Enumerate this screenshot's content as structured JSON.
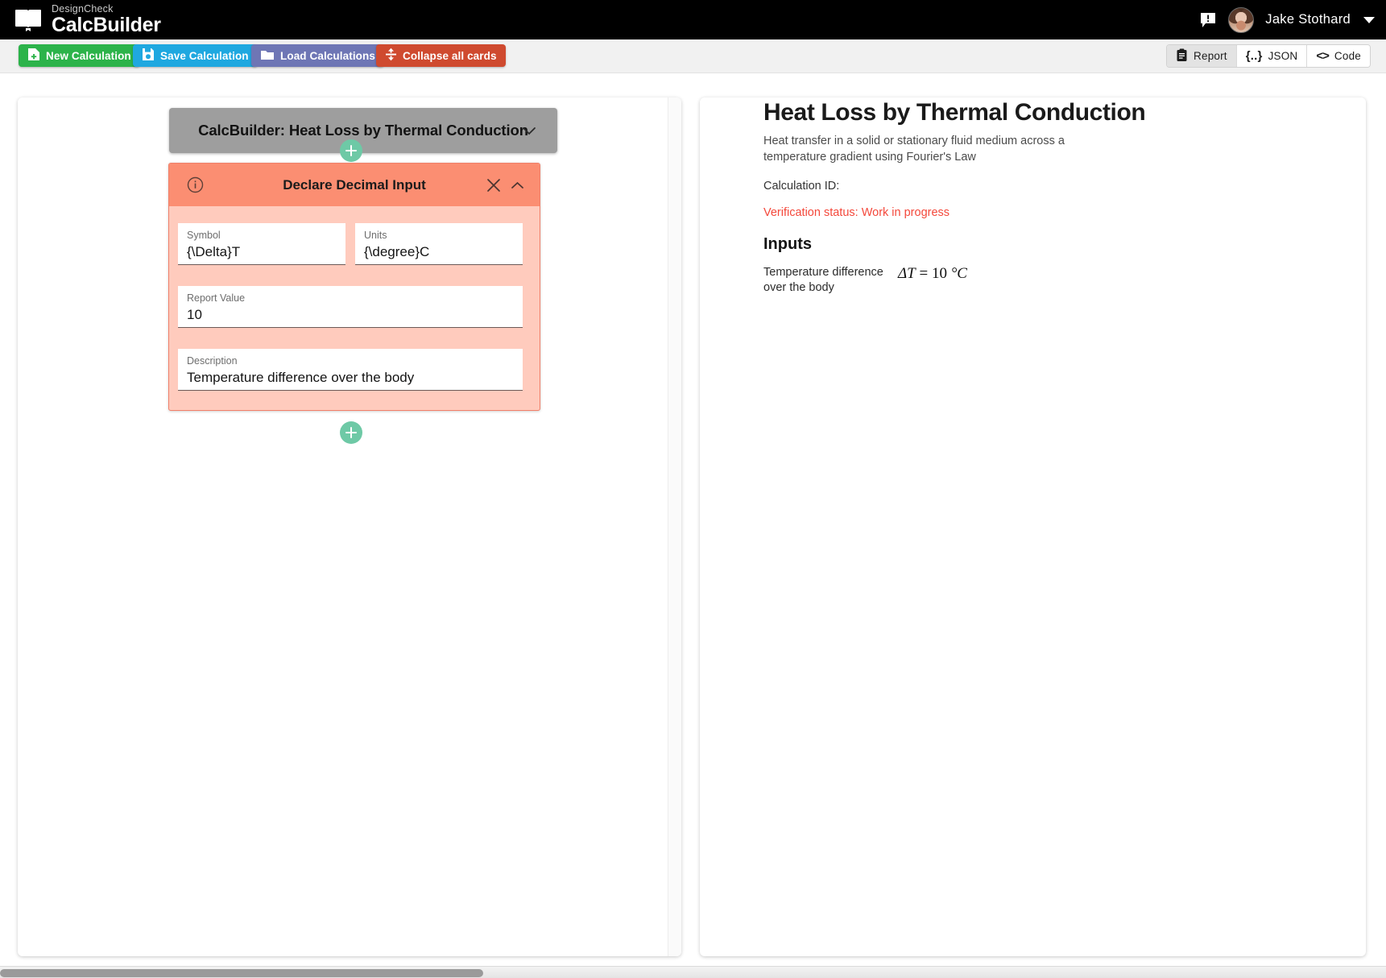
{
  "app": {
    "brand_sub": "DesignCheck",
    "brand_title": "CalcBuilder",
    "logo_icon": "book-icon",
    "message_icon": "message-alert-icon",
    "avatar_icon": "user-avatar",
    "username": "Jake Stothard",
    "user_menu_icon": "caret-down-icon"
  },
  "toolbar": {
    "new_calculation": "New Calculation",
    "new_calculation_icon": "file-plus-icon",
    "save_calculation": "Save Calculation",
    "save_calculation_icon": "floppy-disk-icon",
    "load_calculations": "Load Calculations",
    "load_calculations_icon": "folder-icon",
    "collapse_all": "Collapse all cards",
    "collapse_all_icon": "collapse-arrows-icon",
    "colors": {
      "new": "#2cb34a",
      "save": "#1fa8e0",
      "load": "#6e76b5",
      "collapse": "#cf4a2f"
    }
  },
  "view_toggle": {
    "active": "Report",
    "options": [
      {
        "label": "Report",
        "icon": "clipboard-icon",
        "active": true
      },
      {
        "label": "JSON",
        "icon": "braces-icon",
        "active": false
      },
      {
        "label": "Code",
        "icon": "angle-brackets-icon",
        "active": false
      }
    ]
  },
  "builder": {
    "calc_header": {
      "title": "CalcBuilder: Heat Loss by Thermal Conduction",
      "chevron_icon": "chevron-down-icon"
    },
    "add_button_icon": "plus-icon",
    "card": {
      "title": "Declare Decimal Input",
      "info_icon": "info-circle-icon",
      "close_icon": "close-icon",
      "collapse_icon": "chevron-up-icon",
      "header_color": "#fb8e72",
      "body_color": "#ffcbbd",
      "fields": [
        {
          "label": "Symbol",
          "value": "{\\Delta}T"
        },
        {
          "label": "Units",
          "value": "{\\degree}C"
        },
        {
          "label": "Report Value",
          "value": "10"
        },
        {
          "label": "Description",
          "value": "Temperature difference over the body"
        }
      ]
    }
  },
  "report": {
    "title": "Heat Loss by Thermal Conduction",
    "description": "Heat transfer in a solid or stationary fluid medium across a temperature gradient using Fourier's Law",
    "calculation_id": "Calculation ID:",
    "verification_status": "Verification status: Work in progress",
    "status_color": "#f4483b",
    "inputs_heading": "Inputs",
    "inputs": [
      {
        "label": "Temperature difference over the body",
        "symbol": "ΔT",
        "equals": "=",
        "value": "10",
        "unit": "°C"
      }
    ]
  }
}
